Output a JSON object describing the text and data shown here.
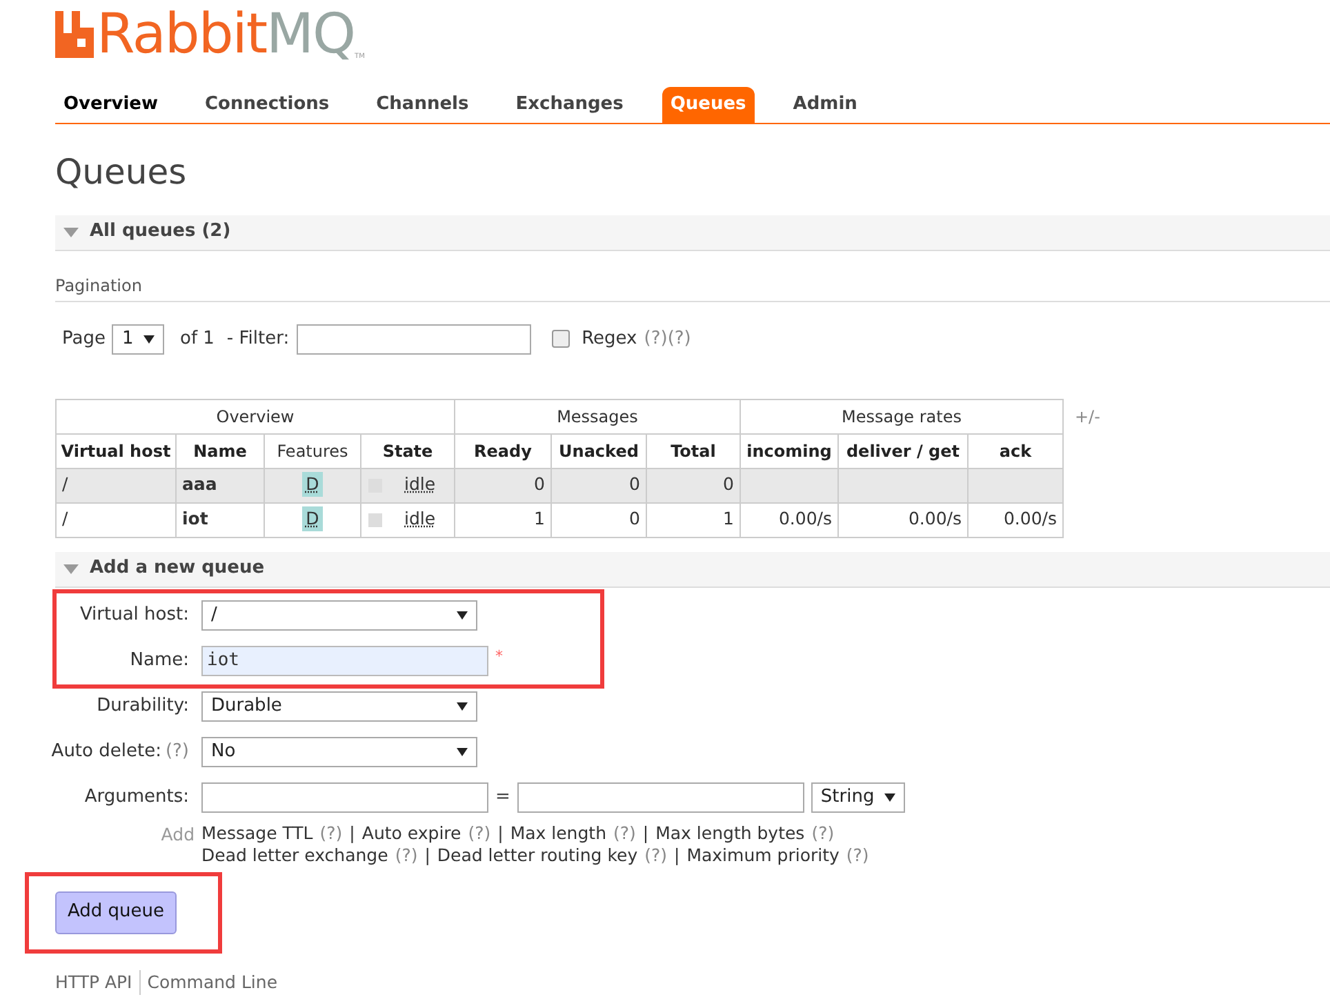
{
  "logo": {
    "word_a": "Rabbit",
    "word_b": "MQ",
    "mark": "TM"
  },
  "nav": [
    {
      "label": "Overview",
      "selected": false
    },
    {
      "label": "Connections",
      "selected": false
    },
    {
      "label": "Channels",
      "selected": false
    },
    {
      "label": "Exchanges",
      "selected": false
    },
    {
      "label": "Queues",
      "selected": true
    },
    {
      "label": "Admin",
      "selected": false
    }
  ],
  "page_title": "Queues",
  "all_queues": {
    "heading": "All queues (2)",
    "expanded": true,
    "pagination": {
      "label": "Pagination",
      "page_label": "Page",
      "page_value": "1",
      "of_label": "of 1",
      "filter_label": "- Filter:",
      "regex_label": "Regex",
      "regex_checked": false,
      "help_marks": [
        "(?)",
        "(?)"
      ]
    },
    "table": {
      "toggle": "+/-",
      "groups": [
        "Overview",
        "Messages",
        "Message rates"
      ],
      "columns": [
        "Virtual host",
        "Name",
        "Features",
        "State",
        "Ready",
        "Unacked",
        "Total",
        "incoming",
        "deliver / get",
        "ack"
      ],
      "rows": [
        {
          "shaded": true,
          "vhost": "/",
          "name": "aaa",
          "feature": "D",
          "state": "idle",
          "ready": "0",
          "unacked": "0",
          "total": "0",
          "rates": []
        },
        {
          "shaded": false,
          "vhost": "/",
          "name": "iot",
          "feature": "D",
          "state": "idle",
          "ready": "1",
          "unacked": "0",
          "total": "1",
          "rates": [
            "0.00/s",
            "0.00/s",
            "0.00/s"
          ]
        }
      ]
    }
  },
  "add_queue": {
    "heading": "Add a new queue",
    "expanded": true,
    "fields": [
      {
        "kind": "select",
        "label": "Virtual host:",
        "value": "/"
      },
      {
        "kind": "input",
        "label": "Name:",
        "value": "iot",
        "required_mark": "*"
      },
      {
        "kind": "select",
        "label": "Durability:",
        "value": "Durable"
      },
      {
        "kind": "select",
        "label": "Auto delete:",
        "help": "(?)",
        "value": "No"
      },
      {
        "kind": "args",
        "label": "Arguments:",
        "equals": "=",
        "type_value": "String"
      }
    ],
    "add_label": "Add",
    "arg_links": [
      [
        {
          "label": "Message TTL",
          "help": "(?)"
        },
        {
          "label": "Auto expire",
          "help": "(?)"
        },
        {
          "label": "Max length",
          "help": "(?)"
        },
        {
          "label": "Max length bytes",
          "help": "(?)"
        }
      ],
      [
        {
          "label": "Dead letter exchange",
          "help": "(?)"
        },
        {
          "label": "Dead letter routing key",
          "help": "(?)"
        },
        {
          "label": "Maximum priority",
          "help": "(?)"
        }
      ]
    ],
    "separator": "|",
    "button": "Add queue"
  },
  "footer": [
    "HTTP API",
    "Command Line"
  ]
}
